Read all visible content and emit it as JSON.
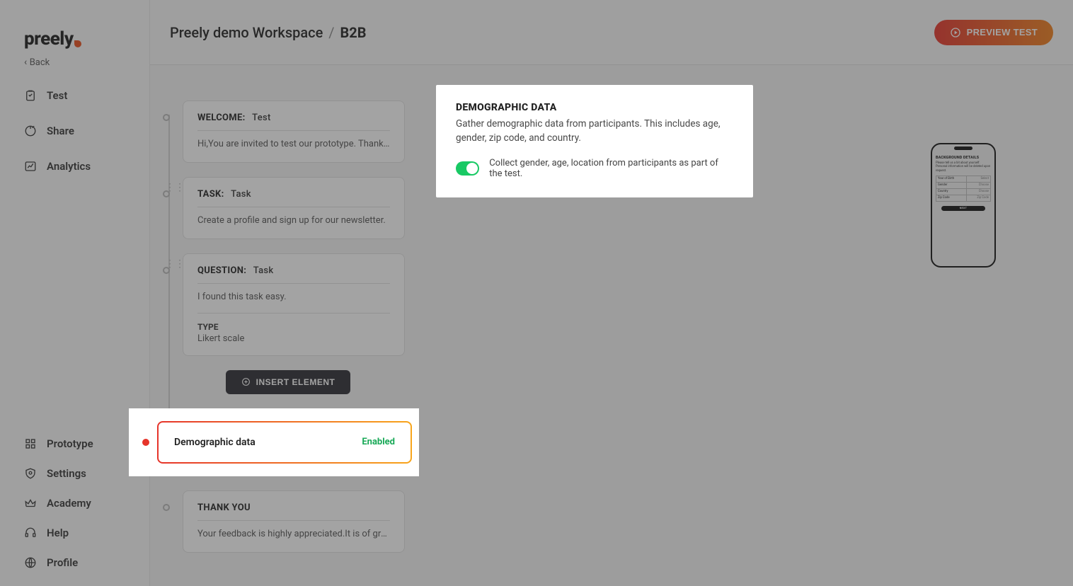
{
  "brand": "preely",
  "back_label": "Back",
  "nav_top": [
    {
      "key": "test",
      "label": "Test"
    },
    {
      "key": "share",
      "label": "Share"
    },
    {
      "key": "analytics",
      "label": "Analytics"
    }
  ],
  "nav_bottom": [
    {
      "key": "prototype",
      "label": "Prototype"
    },
    {
      "key": "settings",
      "label": "Settings"
    },
    {
      "key": "academy",
      "label": "Academy"
    },
    {
      "key": "help",
      "label": "Help"
    },
    {
      "key": "profile",
      "label": "Profile"
    }
  ],
  "breadcrumb": {
    "workspace": "Preely demo Workspace",
    "sep": "/",
    "current": "B2B"
  },
  "preview_button": "PREVIEW TEST",
  "steps": {
    "welcome": {
      "label": "WELCOME:",
      "value": "Test",
      "body": "Hi,You are invited to test our prototype. Thank …"
    },
    "task": {
      "label": "TASK:",
      "value": "Task",
      "body": "Create a profile and sign up for our newsletter."
    },
    "question": {
      "label": "QUESTION:",
      "value": "Task",
      "body": "I found this task easy.",
      "type_label": "TYPE",
      "type_value": "Likert scale"
    },
    "insert_button": "INSERT ELEMENT",
    "demographic": {
      "title": "Demographic data",
      "status": "Enabled"
    },
    "thankyou": {
      "label": "THANK YOU",
      "body": "Your feedback is highly appreciated.It is of gre…"
    }
  },
  "detail": {
    "heading": "DEMOGRAPHIC DATA",
    "desc": "Gather demographic data from participants. This includes age, gender, zip code, and country.",
    "toggle_label": "Collect gender, age, location from participants as part of the test.",
    "toggle_on": true
  },
  "phone": {
    "title": "BACKGROUND DETAILS",
    "desc": "Please tell us a bit about yourself. Personal information will be deleted upon request.",
    "rows": [
      {
        "l": "Year of Birth",
        "r": "Select"
      },
      {
        "l": "Gender",
        "r": "Choose"
      },
      {
        "l": "Country",
        "r": "Choose"
      },
      {
        "l": "Zip Code",
        "r": "Zip Code"
      }
    ],
    "next": "NEXT"
  }
}
